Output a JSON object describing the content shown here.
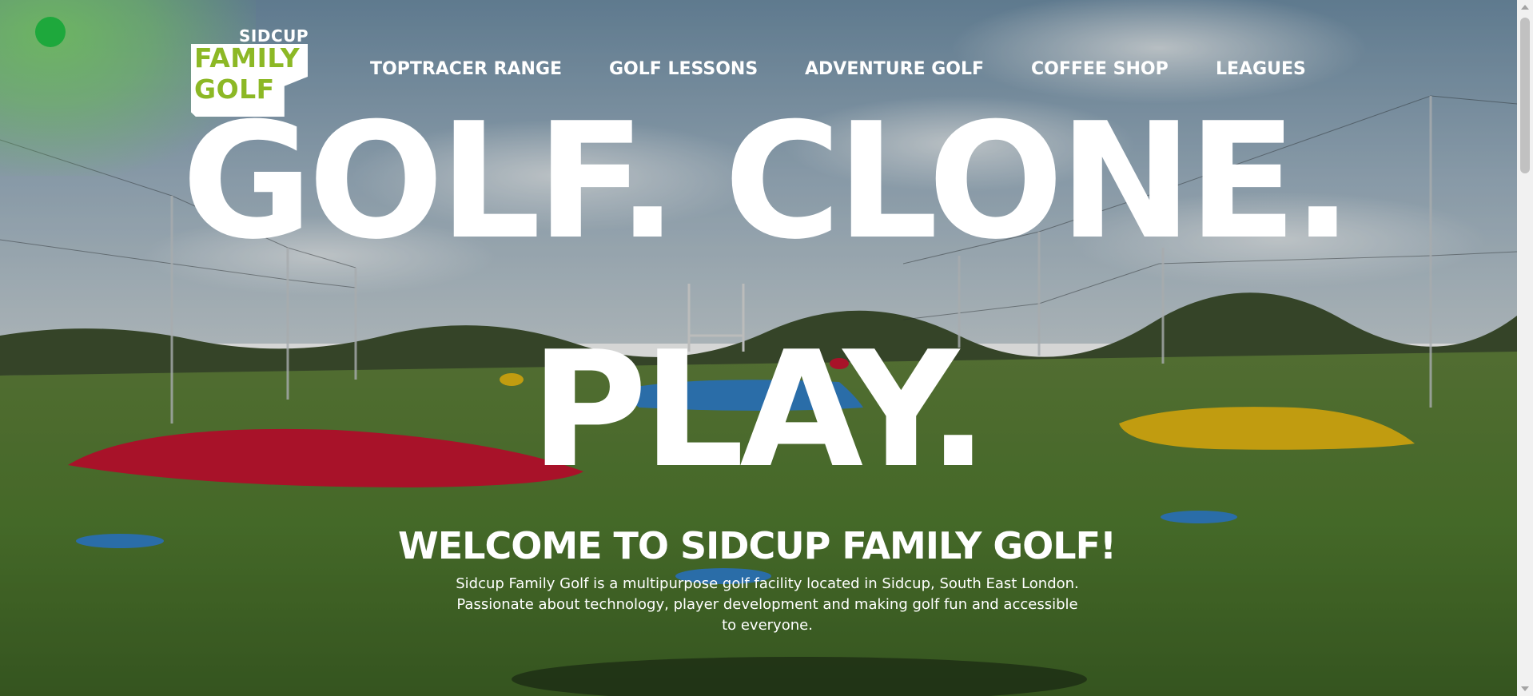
{
  "logo": {
    "top_word": "SIDCUP",
    "line1": "FAMILY",
    "line2": "GOLF"
  },
  "nav": {
    "items": [
      {
        "label": "TOPTRACER RANGE"
      },
      {
        "label": "GOLF LESSONS"
      },
      {
        "label": "ADVENTURE GOLF"
      },
      {
        "label": "COFFEE SHOP"
      },
      {
        "label": "LEAGUES"
      }
    ]
  },
  "hero": {
    "line1": "GOLF. CLONE.",
    "line2": "PLAY.",
    "welcome": "WELCOME TO SIDCUP FAMILY GOLF!",
    "intro": "Sidcup Family Golf is a multipurpose golf facility located in Sidcup, South East London. Passionate about technology, player development and making golf fun and accessible to everyone."
  },
  "colors": {
    "brand_green": "#8cb825",
    "status_dot": "#1ea83c",
    "text": "#ffffff"
  },
  "icons": {
    "status": "status-dot-icon",
    "scroll_up": "scroll-up-arrow-icon",
    "scroll_down": "scroll-down-arrow-icon"
  }
}
